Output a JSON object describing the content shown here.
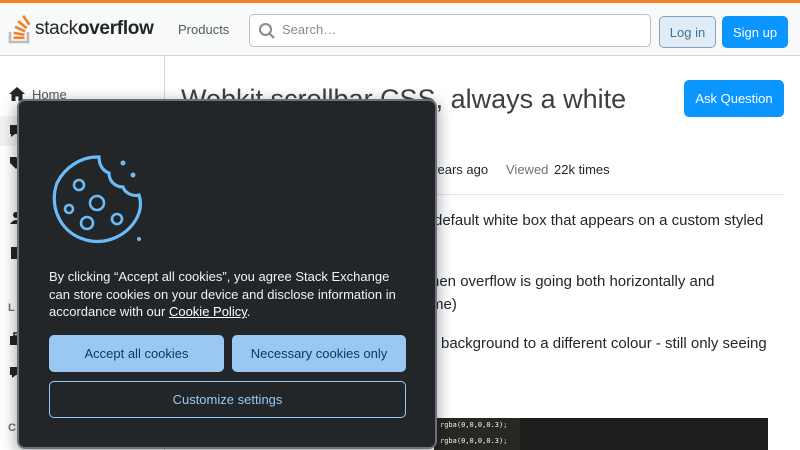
{
  "header": {
    "logo_light": "stack",
    "logo_bold": "overflow",
    "products_label": "Products",
    "search_placeholder": "Search…",
    "login_label": "Log in",
    "signup_label": "Sign up",
    "accent_color": "#f48024"
  },
  "sidebar": {
    "home_label": "Home",
    "labels": [
      "L",
      "C"
    ]
  },
  "question": {
    "title_line1": "Webkit scrollbar CSS, always a white",
    "ask_label": "Ask Question",
    "asked_text": "years ago",
    "viewed_label": "Viewed",
    "viewed_value": "22k times",
    "para1_line1": "default white box that appears on a custom styled",
    "para2_line1": "hen overflow is going both horizontally and",
    "para2_line2": "me)",
    "para3_line1": "background to a different colour - still only seeing"
  },
  "code_snippet": {
    "line1": "rgba(0,0,0,0.3);",
    "line2": "rgba(0,0,0,0.3);"
  },
  "cookie_banner": {
    "text_before_link": "By clicking “Accept all cookies”, you agree Stack Exchange can store cookies on your device and disclose information in accordance with our ",
    "link_text": "Cookie Policy",
    "text_after_link": ".",
    "accept_label": "Accept all cookies",
    "necessary_label": "Necessary cookies only",
    "customize_label": "Customize settings",
    "icon": "cookie-icon",
    "accent_color": "#9ac8f2"
  }
}
